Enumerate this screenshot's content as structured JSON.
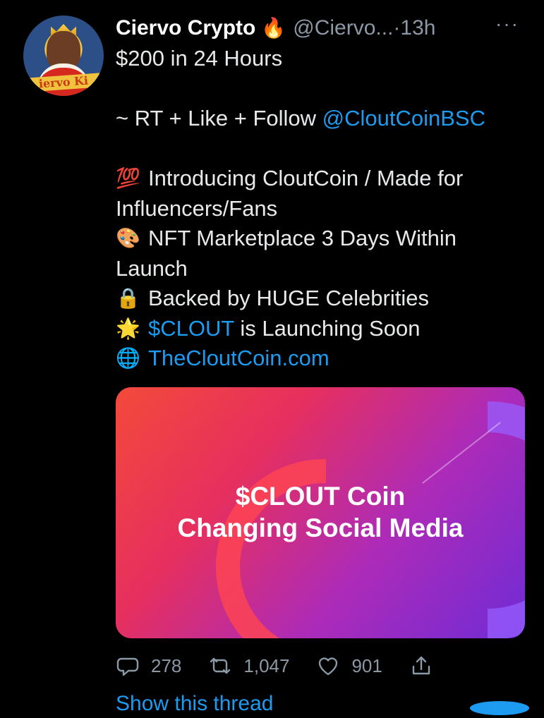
{
  "tweet": {
    "author_name": "Ciervo Crypto",
    "author_emoji": "🔥",
    "handle": "@Ciervo...",
    "time": "·13h",
    "more": "···",
    "avatar_text": "iervo Ki"
  },
  "body": {
    "line1": "$200 in 24 Hours",
    "line2_prefix": "~ RT + Like + Follow ",
    "line2_link": "@CloutCoinBSC",
    "item1_emoji": "💯",
    "item1_text": "Introducing CloutCoin / Made for",
    "item1_text_cont": "Influencers/Fans",
    "item2_emoji": "🎨",
    "item2_text": "NFT Marketplace 3 Days Within",
    "item2_text_cont": "Launch",
    "item3_emoji": "🔒",
    "item3_text": "Backed by HUGE Celebrities",
    "item4_emoji": "🌟",
    "item4_link": "$CLOUT",
    "item4_text": " is Launching Soon",
    "item5_emoji": "🌐",
    "item5_link": "TheCloutCoin.com"
  },
  "media": {
    "line1": "$CLOUT Coin",
    "line2": "Changing Social Media"
  },
  "actions": {
    "replies": "278",
    "retweets": "1,047",
    "likes": "901"
  },
  "footer": {
    "show_thread": "Show this thread"
  }
}
